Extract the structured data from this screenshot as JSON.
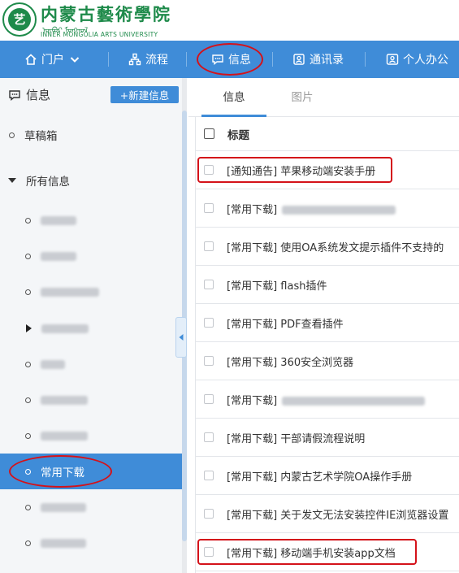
{
  "header": {
    "logo_cn": "内蒙古藝術學院",
    "logo_mn": "ᠥᠪᠥᠷ ᠮᠣᠩᠭᠣᠯ",
    "logo_en": "INNER MONGOLIA ARTS UNIVERSITY"
  },
  "topnav": {
    "items": [
      {
        "label": "门户",
        "icon": "home-icon"
      },
      {
        "label": "流程",
        "icon": "flow-icon"
      },
      {
        "label": "信息",
        "icon": "message-icon"
      },
      {
        "label": "通讯录",
        "icon": "contacts-icon"
      },
      {
        "label": "个人办公",
        "icon": "user-card-icon"
      }
    ],
    "bg_color": "#3f8cd8"
  },
  "sidebar": {
    "title": "信息",
    "new_button": "+新建信息",
    "items": [
      {
        "label": "草稿箱",
        "type": "dot"
      },
      {
        "label": "所有信息",
        "type": "caret-down"
      },
      {
        "label": "",
        "type": "dot",
        "blurred": true
      },
      {
        "label": "",
        "type": "dot",
        "blurred": true
      },
      {
        "label": "",
        "type": "dot",
        "blurred": true
      },
      {
        "label": "",
        "type": "caret-right",
        "blurred": true
      },
      {
        "label": "",
        "type": "dot",
        "blurred": true
      },
      {
        "label": "",
        "type": "dot",
        "blurred": true
      },
      {
        "label": "",
        "type": "dot",
        "blurred": true
      },
      {
        "label": "常用下载",
        "type": "dot",
        "active": true
      },
      {
        "label": "",
        "type": "dot",
        "blurred": true
      },
      {
        "label": "",
        "type": "dot",
        "blurred": true
      }
    ]
  },
  "main": {
    "tabs": [
      {
        "label": "信息",
        "active": true
      },
      {
        "label": "图片",
        "active": false
      }
    ],
    "column_header": "标题",
    "rows": [
      {
        "prefix": "[通知通告]",
        "title": "苹果移动端安装手册"
      },
      {
        "prefix": "[常用下载]",
        "title": "",
        "blurred": true
      },
      {
        "prefix": "[常用下载]",
        "title": "使用OA系统发文提示插件不支持的"
      },
      {
        "prefix": "[常用下载]",
        "title": "flash插件"
      },
      {
        "prefix": "[常用下载]",
        "title": "PDF查看插件"
      },
      {
        "prefix": "[常用下载]",
        "title": "360安全浏览器"
      },
      {
        "prefix": "[常用下载]",
        "title": "",
        "blurred": true
      },
      {
        "prefix": "[常用下载]",
        "title": "干部请假流程说明"
      },
      {
        "prefix": "[常用下载]",
        "title": "内蒙古艺术学院OA操作手册"
      },
      {
        "prefix": "[常用下载]",
        "title": "关于发文无法安装控件IE浏览器设置"
      },
      {
        "prefix": "[常用下载]",
        "title": "移动端手机安装app文档"
      }
    ]
  },
  "colors": {
    "accent": "#3f8cd8",
    "annotation": "#d4121a",
    "logo_green": "#1e8a4a"
  }
}
